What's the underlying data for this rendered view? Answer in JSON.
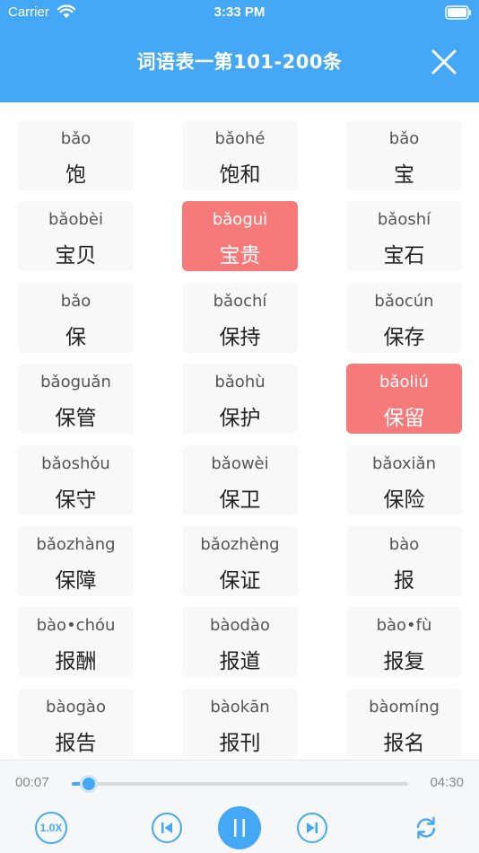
{
  "status_bar": {
    "carrier": "Carrier",
    "time": "3:33 PM"
  },
  "header": {
    "title": "词语表一第101-200条",
    "close_icon": "close-icon"
  },
  "words": [
    {
      "pinyin": "bǎo",
      "hanzi": "饱",
      "active": false
    },
    {
      "pinyin": "bǎohé",
      "hanzi": "饱和",
      "active": false
    },
    {
      "pinyin": "bǎo",
      "hanzi": "宝",
      "active": false
    },
    {
      "pinyin": "bǎobèi",
      "hanzi": "宝贝",
      "active": false
    },
    {
      "pinyin": "bǎoguì",
      "hanzi": "宝贵",
      "active": true
    },
    {
      "pinyin": "bǎoshí",
      "hanzi": "宝石",
      "active": false
    },
    {
      "pinyin": "bǎo",
      "hanzi": "保",
      "active": false
    },
    {
      "pinyin": "bǎochí",
      "hanzi": "保持",
      "active": false
    },
    {
      "pinyin": "bǎocún",
      "hanzi": "保存",
      "active": false
    },
    {
      "pinyin": "bǎoguǎn",
      "hanzi": "保管",
      "active": false
    },
    {
      "pinyin": "bǎohù",
      "hanzi": "保护",
      "active": false
    },
    {
      "pinyin": "bǎoliú",
      "hanzi": "保留",
      "active": true
    },
    {
      "pinyin": "bǎoshǒu",
      "hanzi": "保守",
      "active": false
    },
    {
      "pinyin": "bǎowèi",
      "hanzi": "保卫",
      "active": false
    },
    {
      "pinyin": "bǎoxiǎn",
      "hanzi": "保险",
      "active": false
    },
    {
      "pinyin": "bǎozhàng",
      "hanzi": "保障",
      "active": false
    },
    {
      "pinyin": "bǎozhèng",
      "hanzi": "保证",
      "active": false
    },
    {
      "pinyin": "bào",
      "hanzi": "报",
      "active": false
    },
    {
      "pinyin": "bào•chóu",
      "hanzi": "报酬",
      "active": false
    },
    {
      "pinyin": "bàodào",
      "hanzi": "报道",
      "active": false
    },
    {
      "pinyin": "bào•fù",
      "hanzi": "报复",
      "active": false
    },
    {
      "pinyin": "bàogào",
      "hanzi": "报告",
      "active": false
    },
    {
      "pinyin": "bàokān",
      "hanzi": "报刊",
      "active": false
    },
    {
      "pinyin": "bàomíng",
      "hanzi": "报名",
      "active": false
    }
  ],
  "player": {
    "current_time": "00:07",
    "total_time": "04:30",
    "progress_fraction": 0.05,
    "speed_label": "1.0X",
    "icons": {
      "prev": "skip-previous-icon",
      "play_pause": "pause-icon",
      "next": "skip-next-icon",
      "repeat": "repeat-icon"
    }
  },
  "colors": {
    "accent": "#45a8f7",
    "active_card": "#f77a7a",
    "card_bg": "#f8f8f8"
  }
}
